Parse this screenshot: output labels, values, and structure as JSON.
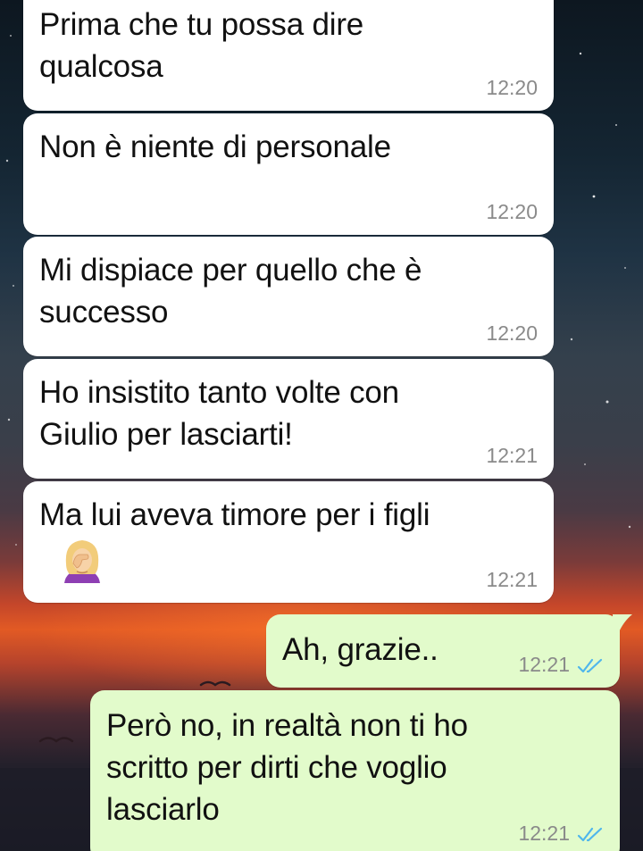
{
  "colors": {
    "incoming_bubble": "#ffffff",
    "outgoing_bubble": "#e2fbcb",
    "timestamp": "#8a8a8a",
    "read_ticks": "#4fb6ec"
  },
  "messages": [
    {
      "direction": "incoming",
      "text": "Prima che tu possa dire\nqualcosa",
      "time": "12:20"
    },
    {
      "direction": "incoming",
      "text": "Non è niente di personale",
      "time": "12:20"
    },
    {
      "direction": "incoming",
      "text": "Mi dispiace per quello che è\nsuccesso",
      "time": "12:20"
    },
    {
      "direction": "incoming",
      "text": "Ho insistito tanto volte con\nGiulio per lasciarti!",
      "time": "12:21"
    },
    {
      "direction": "incoming",
      "text": "Ma lui aveva timore per i figli",
      "emoji": "woman-facepalming",
      "time": "12:21"
    },
    {
      "direction": "outgoing",
      "text": "Ah, grazie..",
      "time": "12:21",
      "status": "read-double-tick-icon"
    },
    {
      "direction": "outgoing",
      "text": "Però no, in realtà non ti ho\nscritto per dirti che voglio\nlasciarlo",
      "time": "12:21",
      "status": "read-double-tick-icon"
    }
  ]
}
